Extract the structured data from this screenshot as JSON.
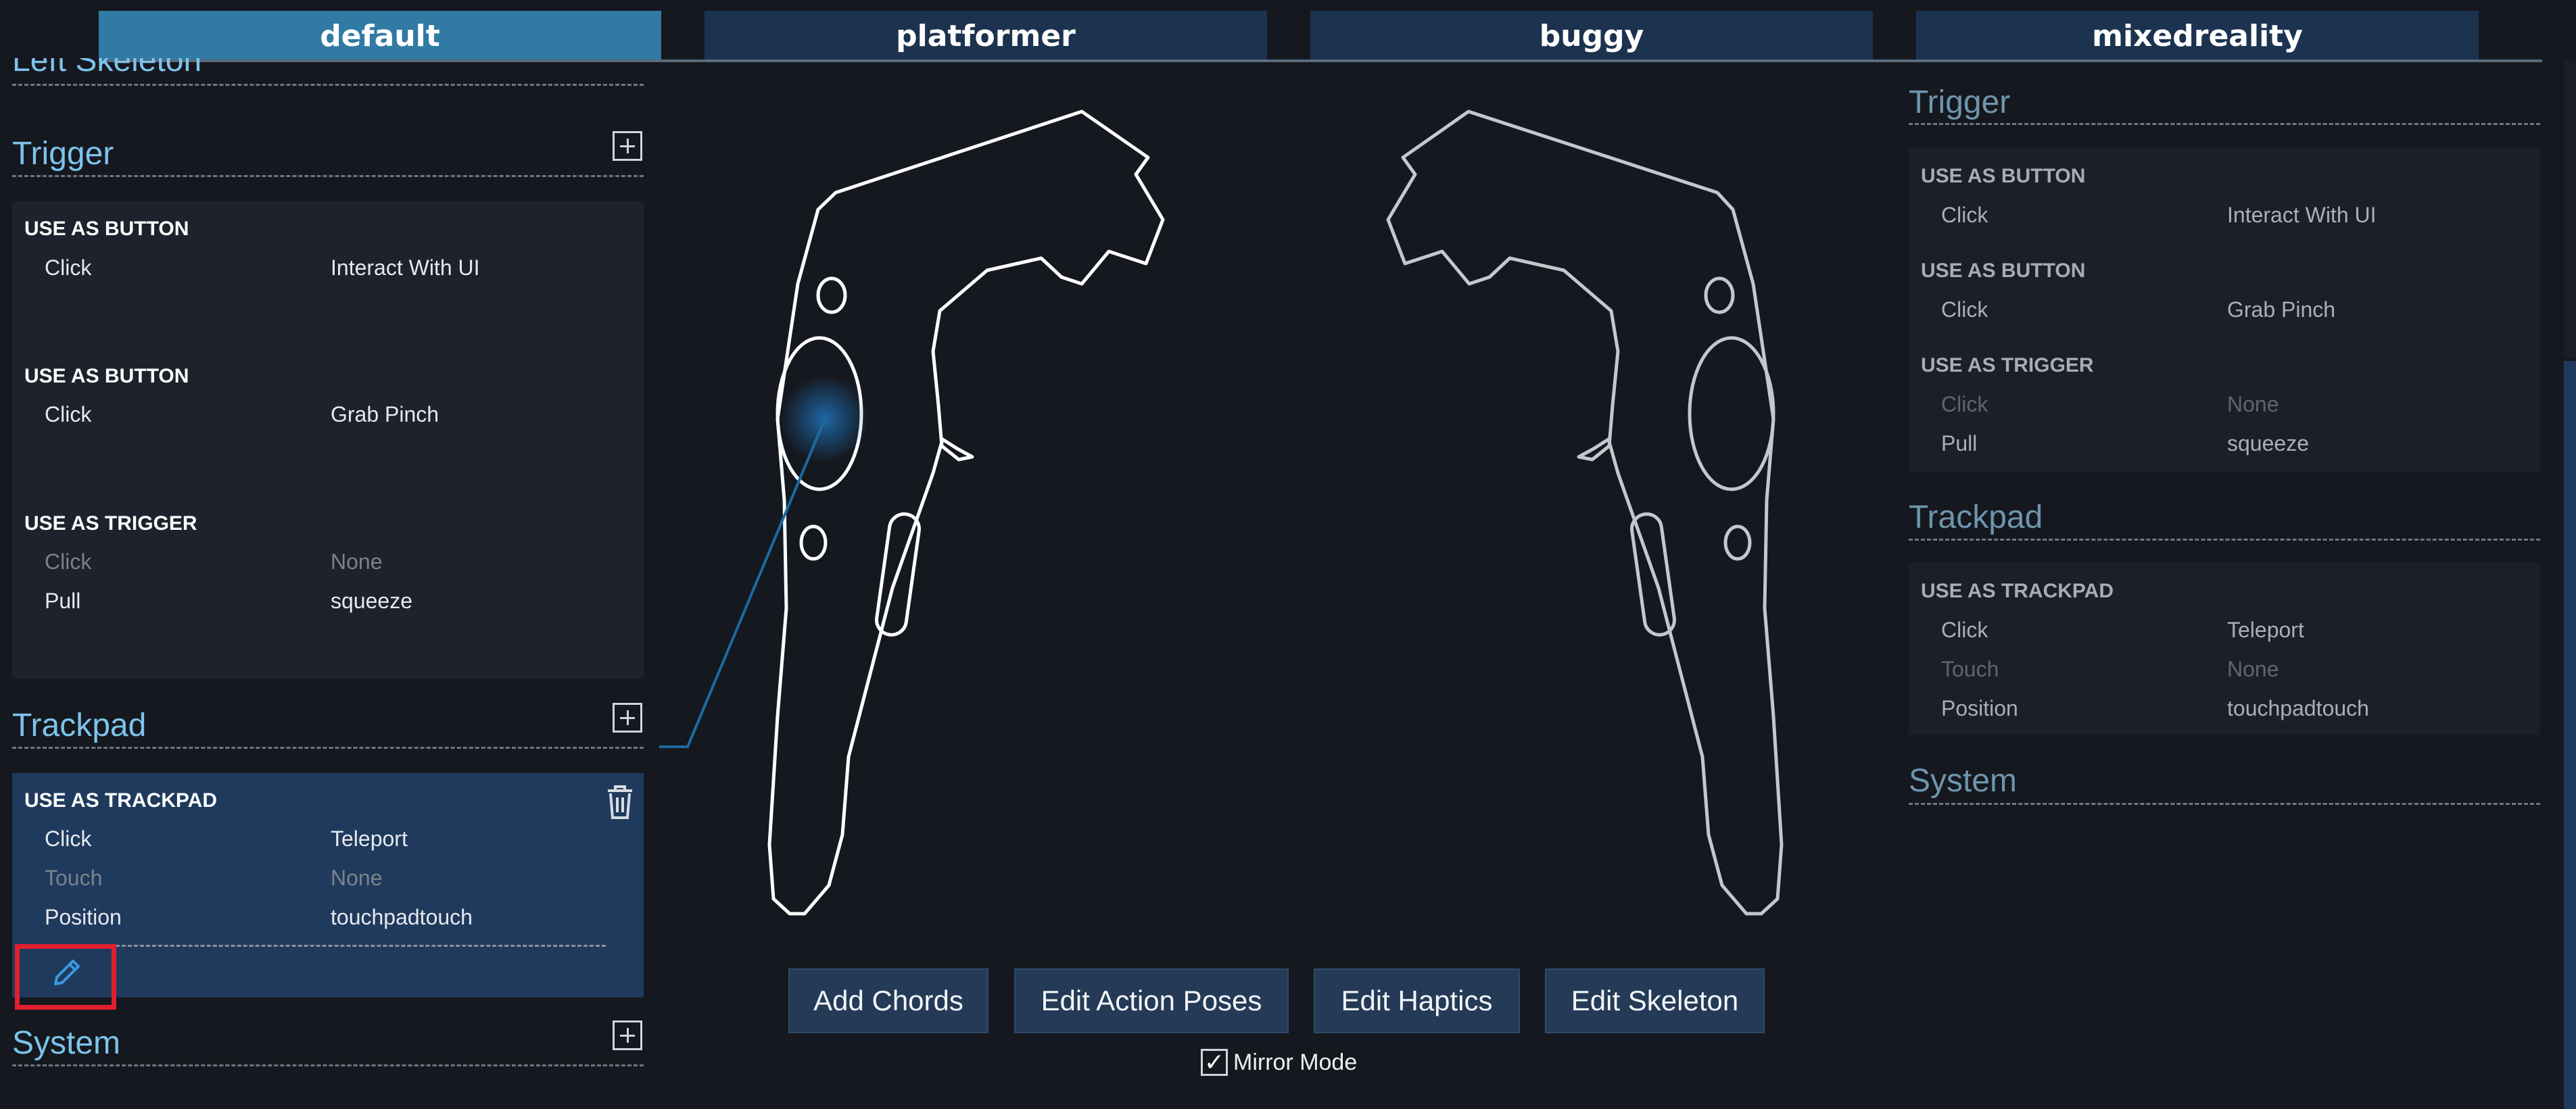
{
  "tabs": [
    {
      "label": "default"
    },
    {
      "label": "platformer"
    },
    {
      "label": "buggy"
    },
    {
      "label": "mixedreality"
    }
  ],
  "left": {
    "cut_title": "Left Skeleton",
    "trigger": {
      "title": "Trigger",
      "groups": [
        {
          "type": "USE AS BUTTON",
          "rows": [
            {
              "label": "Click",
              "value": "Interact With UI"
            }
          ]
        },
        {
          "type": "USE AS BUTTON",
          "rows": [
            {
              "label": "Click",
              "value": "Grab Pinch"
            }
          ]
        },
        {
          "type": "USE AS TRIGGER",
          "rows": [
            {
              "label": "Click",
              "value": "None"
            },
            {
              "label": "Pull",
              "value": "squeeze"
            }
          ]
        }
      ]
    },
    "trackpad": {
      "title": "Trackpad",
      "group": {
        "type": "USE AS TRACKPAD",
        "rows": [
          {
            "label": "Click",
            "value": "Teleport"
          },
          {
            "label": "Touch",
            "value": "None"
          },
          {
            "label": "Position",
            "value": "touchpadtouch"
          }
        ]
      }
    },
    "system": {
      "title": "System"
    }
  },
  "right": {
    "trigger": {
      "title": "Trigger",
      "groups": [
        {
          "type": "USE AS BUTTON",
          "rows": [
            {
              "label": "Click",
              "value": "Interact With UI"
            }
          ]
        },
        {
          "type": "USE AS BUTTON",
          "rows": [
            {
              "label": "Click",
              "value": "Grab Pinch"
            }
          ]
        },
        {
          "type": "USE AS TRIGGER",
          "rows": [
            {
              "label": "Click",
              "value": "None"
            },
            {
              "label": "Pull",
              "value": "squeeze"
            }
          ]
        }
      ]
    },
    "trackpad": {
      "title": "Trackpad",
      "group": {
        "type": "USE AS TRACKPAD",
        "rows": [
          {
            "label": "Click",
            "value": "Teleport"
          },
          {
            "label": "Touch",
            "value": "None"
          },
          {
            "label": "Position",
            "value": "touchpadtouch"
          }
        ]
      }
    },
    "system": {
      "title": "System"
    }
  },
  "actions": {
    "add_chords": "Add Chords",
    "edit_action_poses": "Edit Action Poses",
    "edit_haptics": "Edit Haptics",
    "edit_skeleton": "Edit Skeleton"
  },
  "mirror": {
    "label": "Mirror Mode",
    "checked": true,
    "check_glyph": "✓"
  },
  "colors": {
    "accent": "#317aa4",
    "tab_inactive": "#1c3350",
    "selected_panel": "#1f3a5c",
    "highlight_box": "#e01f2e"
  },
  "icons": {
    "add": "plus-square-icon",
    "delete": "trash-icon",
    "edit": "pencil-icon"
  }
}
